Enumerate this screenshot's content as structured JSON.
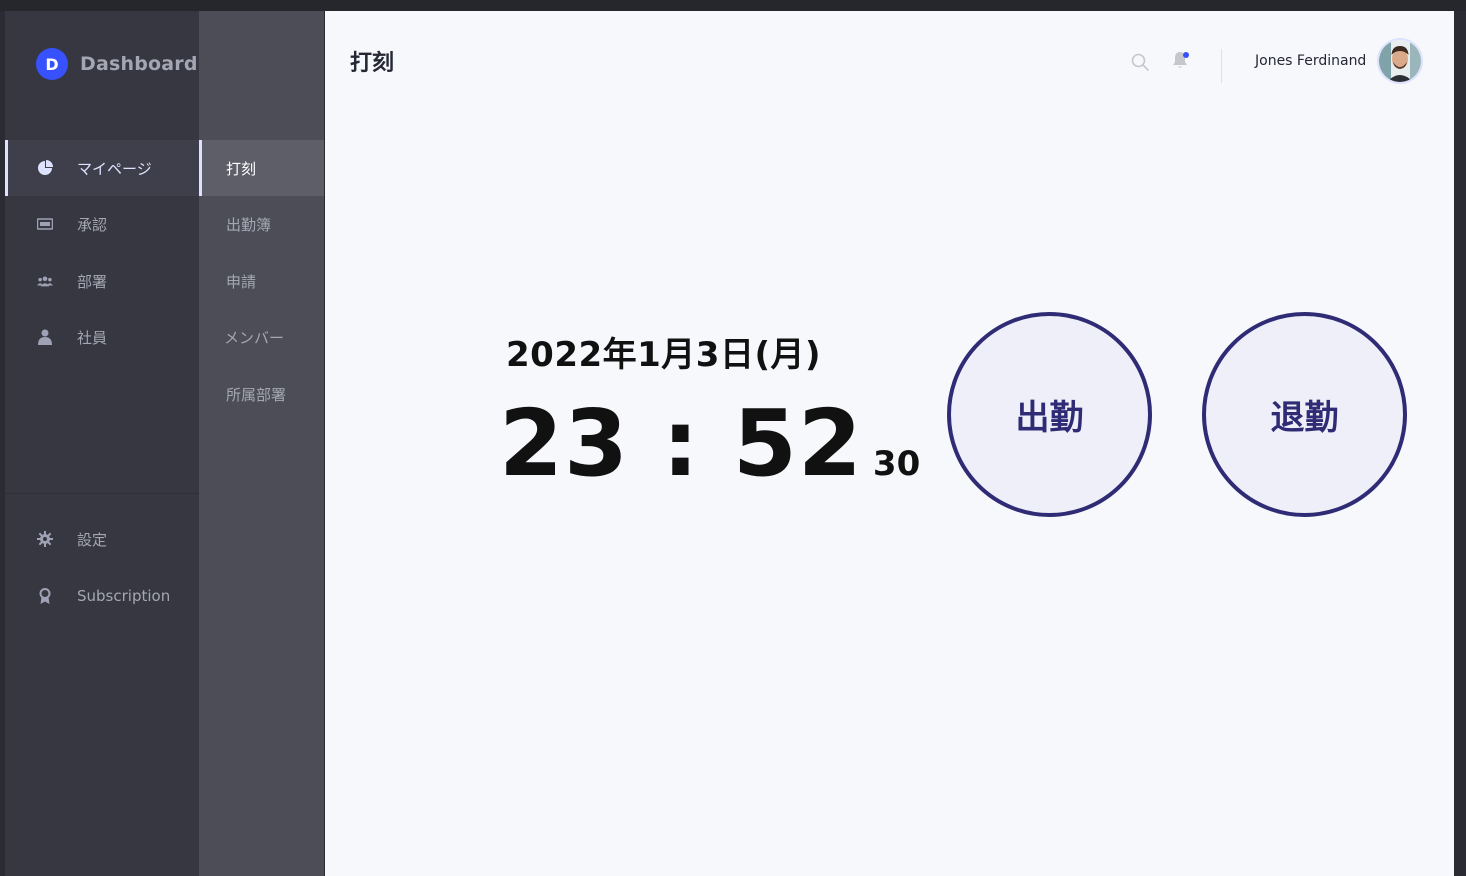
{
  "brand": {
    "logo_letter": "D",
    "name": "Dashboard Kit"
  },
  "sidebar": {
    "items": [
      {
        "label": "マイページ",
        "icon": "pie-chart-icon",
        "active": true
      },
      {
        "label": "承認",
        "icon": "ticket-icon",
        "active": false
      },
      {
        "label": "部署",
        "icon": "users-icon",
        "active": false
      },
      {
        "label": "社員",
        "icon": "person-icon",
        "active": false
      }
    ],
    "bottom_items": [
      {
        "label": "設定",
        "icon": "gear-icon"
      },
      {
        "label": "Subscription",
        "icon": "award-icon"
      }
    ]
  },
  "subnav": {
    "items": [
      {
        "label": "打刻",
        "active": true
      },
      {
        "label": "出勤簿",
        "active": false
      },
      {
        "label": "申請",
        "active": false
      },
      {
        "label": "メンバー",
        "active": false
      },
      {
        "label": "所属部署",
        "active": false
      }
    ]
  },
  "header": {
    "title": "打刻",
    "user_name": "Jones Ferdinand",
    "search_icon": "search-icon",
    "bell_icon": "bell-icon",
    "has_notification": true
  },
  "clock": {
    "date": "2022年1月3日(月)",
    "hours_minutes": "23 : 52",
    "seconds": "30"
  },
  "actions": {
    "clock_in": "出勤",
    "clock_out": "退勤"
  },
  "colors": {
    "accent": "#3751ff",
    "button_border": "#2f2c75",
    "button_fill": "#efeff9",
    "sidebar_bg": "#363740",
    "subnav_bg": "#4c4d57",
    "main_bg": "#f7f8fc"
  }
}
